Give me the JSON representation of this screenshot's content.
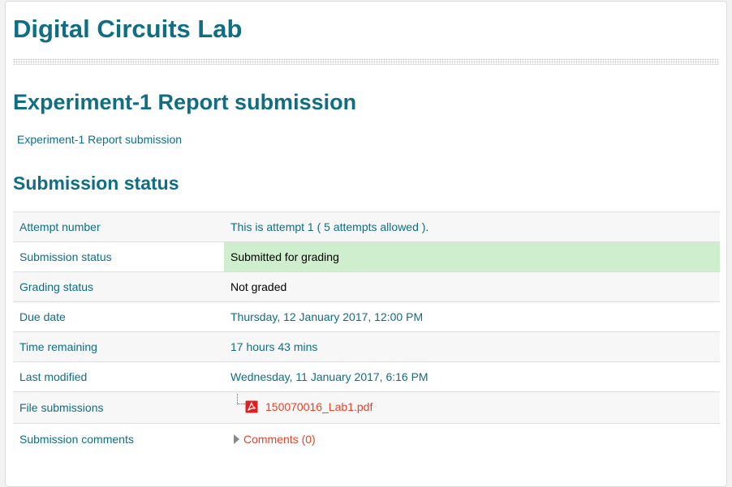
{
  "course": {
    "title": "Digital Circuits Lab"
  },
  "assignment": {
    "title": "Experiment-1 Report submission",
    "intro": "Experiment-1 Report submission"
  },
  "submission_status": {
    "heading": "Submission status",
    "rows": [
      {
        "label": "Attempt number",
        "value": "This is attempt 1 ( 5 attempts allowed )."
      },
      {
        "label": "Submission status",
        "value": "Submitted for grading"
      },
      {
        "label": "Grading status",
        "value": "Not graded"
      },
      {
        "label": "Due date",
        "value": "Thursday, 12 January 2017, 12:00 PM"
      },
      {
        "label": "Time remaining",
        "value": "17 hours 43 mins"
      },
      {
        "label": "Last modified",
        "value": "Wednesday, 11 January 2017, 6:16 PM"
      },
      {
        "label": "File submissions",
        "file_name": "150070016_Lab1.pdf",
        "file_icon": "pdf-icon"
      },
      {
        "label": "Submission comments",
        "comments_link": "Comments (0)",
        "toggle_icon": "triangle-right-icon"
      }
    ]
  },
  "colors": {
    "heading": "#0f6e84",
    "link": "#e5432a",
    "submitted_bg": "#cfeecd"
  }
}
